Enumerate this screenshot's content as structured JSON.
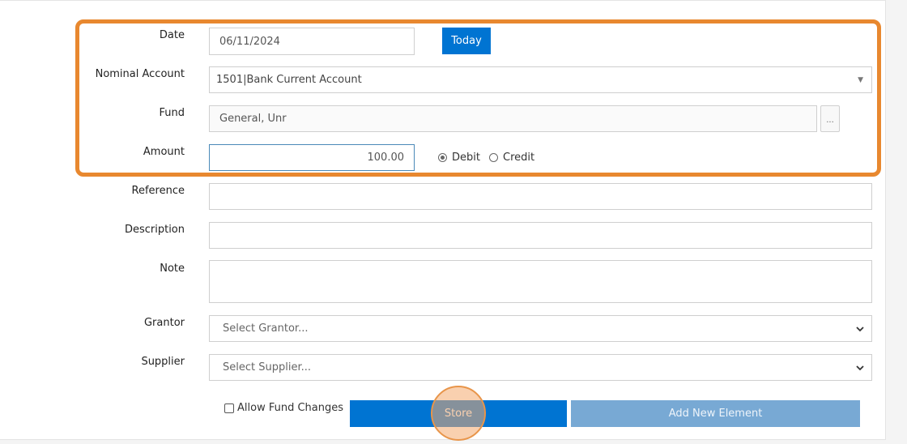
{
  "form": {
    "date": {
      "label": "Date",
      "value": "06/11/2024",
      "today_label": "Today"
    },
    "nominal_account": {
      "label": "Nominal Account",
      "value": "1501|Bank Current Account"
    },
    "fund": {
      "label": "Fund",
      "value": "General, Unr",
      "browse_label": "..."
    },
    "amount": {
      "label": "Amount",
      "value": "100.00",
      "debit_label": "Debit",
      "credit_label": "Credit",
      "selected": "Debit"
    },
    "reference": {
      "label": "Reference",
      "value": ""
    },
    "description": {
      "label": "Description",
      "value": ""
    },
    "note": {
      "label": "Note",
      "value": ""
    },
    "grantor": {
      "label": "Grantor",
      "placeholder": "Select Grantor..."
    },
    "supplier": {
      "label": "Supplier",
      "placeholder": "Select Supplier..."
    }
  },
  "footer": {
    "allow_fund_changes_label": "Allow Fund Changes",
    "allow_fund_changes_checked": false,
    "store_label": "Store",
    "add_new_element_label": "Add New Element"
  },
  "colors": {
    "primary_button": "#0074d2",
    "disabled_button": "#78a9d4",
    "highlight": "#e8882f"
  }
}
